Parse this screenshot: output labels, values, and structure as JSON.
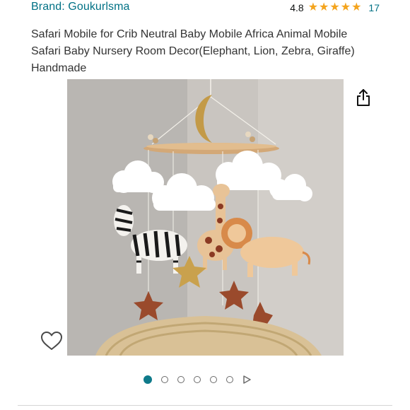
{
  "header": {
    "brand": "Brand: Goukurlsma",
    "rating": "4.8",
    "rating_count": "17",
    "star_count": 5
  },
  "product": {
    "title": "Safari Mobile for Crib Neutral Baby Mobile Africa Animal Mobile Safari Baby Nursery Room Decor(Elephant, Lion, Zebra, Giraffe) Handmade"
  },
  "gallery": {
    "image_count": 6,
    "active_index": 0
  },
  "colors": {
    "link": "#007185",
    "star": "#f4a41d",
    "active_dot": "#0f7a8a"
  },
  "icons": [
    "share-icon",
    "heart-icon",
    "star-icon",
    "play-icon"
  ]
}
